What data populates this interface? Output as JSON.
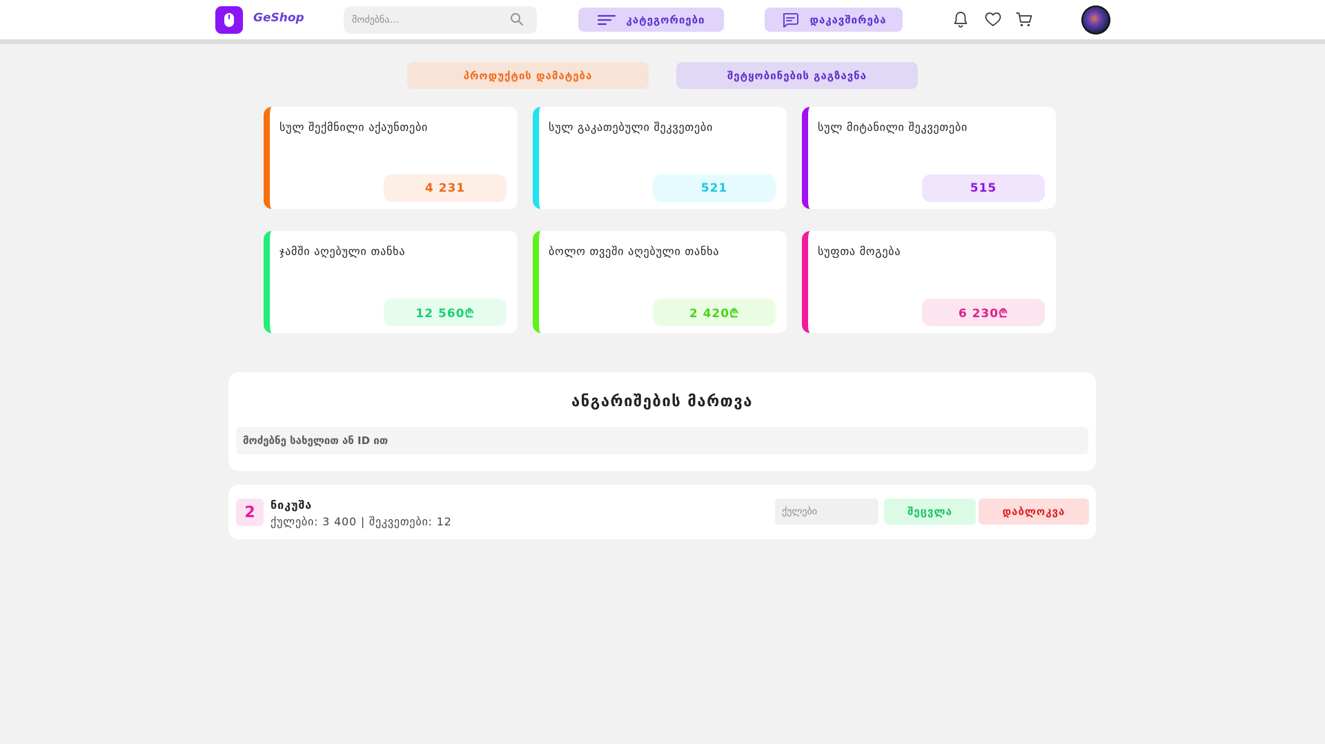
{
  "header": {
    "brand": "GeShop",
    "search_placeholder": "მოძებნა...",
    "categories_label": "კატეგორიები",
    "contact_label": "დაკავშირება"
  },
  "actions": {
    "add_product_label": "პროდუქტის დამატება",
    "send_message_label": "შეტყობინების გაგზავნა"
  },
  "stats": [
    {
      "title": "სულ შექმნილი აქაუნთები",
      "value": "4 231",
      "accent": "#f7710e",
      "badge_bg": "#fdefe6",
      "badge_color": "#ee6a1b"
    },
    {
      "title": "სულ გაკათებული შეკვეთები",
      "value": "521",
      "accent": "#1fe3f0",
      "badge_bg": "#e5fbfd",
      "badge_color": "#1cc7e1"
    },
    {
      "title": "სულ მიტანილი შეკვეთები",
      "value": "515",
      "accent": "#a10ff2",
      "badge_bg": "#f1e4fd",
      "badge_color": "#8f15dc"
    },
    {
      "title": "ჯამში აღებული თანხა",
      "value": "12 560₾",
      "accent": "#20ee78",
      "badge_bg": "#e6fcef",
      "badge_color": "#19d271"
    },
    {
      "title": "ბოლო თვეში აღებული თანხა",
      "value": "2 420₾",
      "accent": "#5cf21c",
      "badge_bg": "#eafde2",
      "badge_color": "#48d61a"
    },
    {
      "title": "სუფთა მოგება",
      "value": "6 230₾",
      "accent": "#f01c9a",
      "badge_bg": "#fde4f1",
      "badge_color": "#e0208f"
    }
  ],
  "accounts": {
    "title": "ანგარიშების მართვა",
    "search_placeholder": "მოძებნე სახელით ან ID ით"
  },
  "user": {
    "id": "2",
    "name": "ნიკუშა",
    "meta": "ქულები: 3 400 | შეკვეთები: 12",
    "points_placeholder": "ქულები",
    "change_label": "შეცვლა",
    "block_label": "დაბლოკვა"
  }
}
